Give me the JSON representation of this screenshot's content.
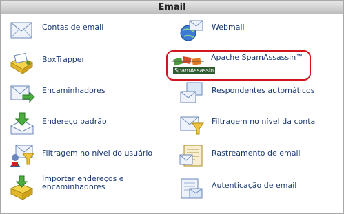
{
  "panel": {
    "title": "Email"
  },
  "items": [
    {
      "label": "Contas de email",
      "icon": "envelope-icon"
    },
    {
      "label": "Webmail",
      "icon": "globe-envelope-icon"
    },
    {
      "label": "BoxTrapper",
      "icon": "box-envelope-icon"
    },
    {
      "label": "Apache SpamAssassin™",
      "icon": "spamassassin-logo-icon",
      "logo_text": "SpamAssassin"
    },
    {
      "label": "Encaminhadores",
      "icon": "envelope-forward-icon"
    },
    {
      "label": "Respondentes automáticos",
      "icon": "envelope-autoresponder-icon"
    },
    {
      "label": "Endereço padrão",
      "icon": "envelope-default-icon"
    },
    {
      "label": "Filtragem no nível da conta",
      "icon": "envelope-filter-icon"
    },
    {
      "label": "Filtragem no nível do usuário",
      "icon": "user-filter-icon"
    },
    {
      "label": "Rastreamento de email",
      "icon": "email-tracking-icon"
    },
    {
      "label_line1": "Importar endereços e",
      "label_line2": "encaminhadores",
      "icon": "import-box-icon"
    },
    {
      "label": "Autenticação de email",
      "icon": "email-authentication-icon"
    }
  ],
  "colors": {
    "link": "#1a3a72",
    "highlight_border": "#d3161d",
    "header_bg": "#cfcfcf"
  }
}
